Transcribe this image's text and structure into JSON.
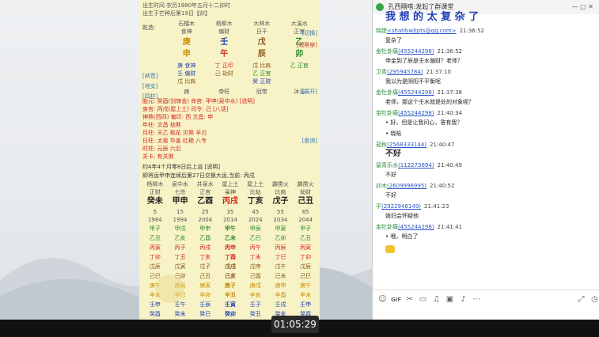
{
  "video": {
    "timestamp": "01:05:29"
  },
  "phone": {
    "birth_line1": "出生时间  农历1980年五月十二卯时",
    "birth_line2": "出生于芒种后第19日【卯】",
    "header_cols": [
      "石榴木",
      "杨柳木",
      "大林木",
      "大溪水"
    ],
    "sub_cols": [
      "食神",
      "偏财",
      "日干",
      "正官"
    ],
    "qiankao_label": "乾造:",
    "gan": [
      "庚",
      "壬",
      "戊",
      "乙"
    ],
    "zhi": [
      "申",
      "午",
      "辰",
      "卯"
    ],
    "tag_switch": "[切换]",
    "tag_pattern": "[观察穿]",
    "canggan_row1": [
      "庚 食神",
      "丁 正印",
      "戊 比肩",
      "乙 正官"
    ],
    "canggan_row2": [
      "壬 偏财",
      "己 劫财",
      "乙 正官",
      ""
    ],
    "canggan_row3": [
      "戊 比肩",
      "",
      "癸 正财",
      ""
    ],
    "left_tags": [
      "[纳音]",
      "[地支]",
      "[四柱]"
    ],
    "changsheng": [
      "病",
      "帝旺",
      "冠带",
      "沐浴"
    ],
    "tag_expand": "[展开]",
    "lines": [
      "胎元: 癸酉(剑锋金)  命宫: 甲申(泉中水)  [说明]",
      "身宫: 丙戌(屋上土)  司令: 己  [八话]",
      "神煞(西四) 偏印: 西  文昌: 申",
      "年柱: 文昌  劫煞",
      "月柱: 天乙  桃花  灾煞  羊刃",
      "日柱: 太极  华盖  红艳  八专",
      "时柱: 元辰  六厄",
      "关卡: 有关煞"
    ],
    "tag_query": "[查询]",
    "qiyun": "约4年4个月零8日后上运  [说明]",
    "dayun_line": "即将运甲申连续后第27日交换大运,当前: 丙戌",
    "dayun_nayin": [
      "杨柳木",
      "泉中水",
      "井泉水",
      "屋上土",
      "屋上土",
      "霹雳火",
      "霹雳火"
    ],
    "dayun_shishen": [
      "正财",
      "七杀",
      "正官",
      "枭神",
      "比劫",
      "比肩",
      "劫财"
    ],
    "dayun_gz": [
      "癸未",
      "甲申",
      "乙酉",
      "丙戌",
      "丁亥",
      "戊子",
      "己丑"
    ],
    "dayun_age": [
      "5",
      "15",
      "25",
      "35",
      "45",
      "55",
      "65"
    ],
    "dayun_year": [
      "1984",
      "1994",
      "2004",
      "2014",
      "2024",
      "2034",
      "2044"
    ],
    "liunian": [
      [
        "甲子",
        "甲戌",
        "甲申",
        "甲午",
        "甲辰",
        "甲寅",
        "甲子"
      ],
      [
        "乙丑",
        "乙亥",
        "乙酉",
        "乙未",
        "乙巳",
        "乙卯",
        "乙丑"
      ],
      [
        "丙寅",
        "丙子",
        "丙戌",
        "丙申",
        "丙午",
        "丙辰",
        "丙寅"
      ],
      [
        "丁卯",
        "丁丑",
        "丁亥",
        "丁酉",
        "丁未",
        "丁巳",
        "丁卯"
      ],
      [
        "戊辰",
        "戊寅",
        "戊子",
        "戊戌",
        "戊申",
        "戊午",
        "戊辰"
      ],
      [
        "己巳",
        "己卯",
        "己丑",
        "己亥",
        "己酉",
        "己未",
        "己巳"
      ],
      [
        "庚午",
        "庚辰",
        "庚寅",
        "庚子",
        "庚戌",
        "庚申",
        "庚午"
      ],
      [
        "辛未",
        "辛巳",
        "辛卯",
        "辛丑",
        "辛亥",
        "辛酉",
        "辛未"
      ],
      [
        "壬申",
        "壬午",
        "壬辰",
        "壬寅",
        "壬子",
        "壬戌",
        "壬申"
      ],
      [
        "癸酉",
        "癸未",
        "癸巳",
        "癸卯",
        "癸丑",
        "癸亥",
        "癸酉"
      ]
    ]
  },
  "chat": {
    "title": "孔西隔嗒:发起了群课堂",
    "banner": "我 想 的 太 复 杂 了",
    "messages": [
      {
        "name": "晓婕",
        "qq": "<shatibwjtpts@qq.com>",
        "time": "21:36:52",
        "body": "复杂了"
      },
      {
        "name": "金牡卦痛",
        "qq": "(455244298)",
        "time": "21:36:52",
        "body": "申金到了辰是壬水偏财？老师？"
      },
      {
        "name": "卫青",
        "qq": "(295945784)",
        "time": "21:37:10",
        "body": "我以为是阴阳不平衡呢"
      },
      {
        "name": "金牡卦痛",
        "qq": "(455244298)",
        "time": "21:37:38",
        "body": "老师，那这个壬水就是处的对象呢？"
      },
      {
        "name": "金牡卦痛",
        "qq": "(455244298)",
        "time": "21:40:34",
        "body": "• 好，但是让我问心，答有我？"
      },
      {
        "name": "",
        "qq": "",
        "time": "",
        "body": "• 晓晗"
      },
      {
        "name": "茄秋",
        "qq": "(2568333144)",
        "time": "21:40:47",
        "body": "不好"
      },
      {
        "name": "留青乐水",
        "qq": "(112273694)",
        "time": "21:40:49",
        "body": "不好"
      },
      {
        "name": "卯木",
        "qq": "(2609996995)",
        "time": "21:40:52",
        "body": "不好"
      },
      {
        "name": "平",
        "qq": "(2922946149)",
        "time": "21:41:23",
        "body": "媳妇会怀疑他"
      },
      {
        "name": "金牡卦痛",
        "qq": "(455244298)",
        "time": "21:41:41",
        "body": "• 哦，明白了"
      }
    ]
  },
  "colors": {
    "accent_blue": "#2a55c8",
    "name_green": "#2a8a3a",
    "fire_red": "#d3251f",
    "wood_green": "#2b8a2b",
    "metal_orange": "#c98b00"
  }
}
